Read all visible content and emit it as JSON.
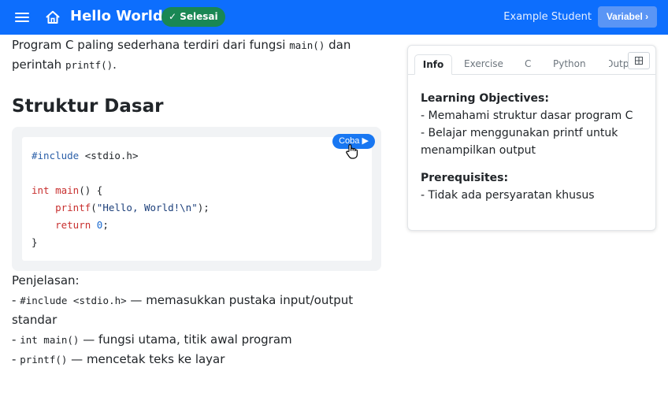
{
  "header": {
    "title": "Hello World",
    "status_badge": "✓ Selesai",
    "user_name": "Example Student",
    "variable_button": "Variabel ›",
    "menu_icon": "hamburger-menu-icon",
    "home_icon": "home-icon",
    "colors": {
      "bar": "#0d6efd",
      "badge": "#198754"
    }
  },
  "main": {
    "intro_line1_pre": "Program C paling sederhana terdiri dari fungsi ",
    "intro_code1": "main()",
    "intro_line1_post": " dan",
    "intro_line2_pre": "perintah ",
    "intro_code2": "printf()",
    "intro_line2_post": ".",
    "section_heading": "Struktur Dasar",
    "try_button": "Coba ▶",
    "code": {
      "line1_pre": "#include",
      "line1_rest": " <stdio.h>",
      "line3_kw": "int",
      "line3_fn": " main",
      "line3_rest": "() {",
      "line4_indent": "    ",
      "line4_fn": "printf",
      "line4_open": "(",
      "line4_str": "\"Hello, World!\\n\"",
      "line4_close": ");",
      "line5_indent": "    ",
      "line5_kw": "return",
      "line5_sp": " ",
      "line5_num": "0",
      "line5_end": ";",
      "line6": "}"
    },
    "explain_title": "Penjelasan:",
    "explain_items": [
      {
        "dash": "- ",
        "code": "#include <stdio.h>",
        "text": " — memasukkan pustaka input/output",
        "cont": "standar"
      },
      {
        "dash": "- ",
        "code": "int main()",
        "text": " — fungsi utama, titik awal program"
      },
      {
        "dash": "- ",
        "code": "printf()",
        "text": " — mencetak teks ke layar"
      }
    ]
  },
  "panel": {
    "tabs": [
      "Info",
      "Exercise",
      "C",
      "Python",
      "Outp"
    ],
    "active_tab": "Info",
    "expand_icon": "expand-grid-icon",
    "objectives_title": "Learning Objectives:",
    "objectives": [
      "- Memahami struktur dasar program C",
      "- Belajar menggunakan printf untuk menampilkan output"
    ],
    "prereq_title": "Prerequisites:",
    "prereqs": [
      "- Tidak ada persyaratan khusus"
    ]
  }
}
